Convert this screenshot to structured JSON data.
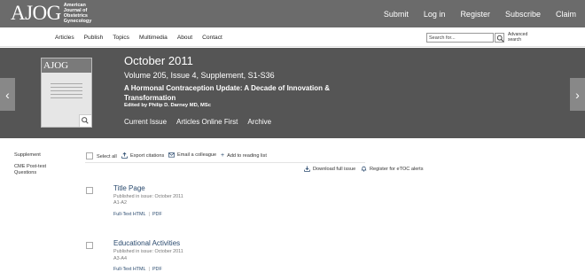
{
  "header": {
    "logo_main": "AJOG",
    "logo_sub": [
      "American",
      "Journal of",
      "Obstetrics",
      "Gynecology"
    ],
    "nav": [
      "Submit",
      "Log in",
      "Register",
      "Subscribe",
      "Claim"
    ]
  },
  "secondary_nav": {
    "items": [
      "Articles",
      "Publish",
      "Topics",
      "Multimedia",
      "About",
      "Contact"
    ],
    "search_placeholder": "Search for...",
    "advanced_search": [
      "Advanced",
      "search"
    ]
  },
  "issue": {
    "title": "October 2011",
    "volume": "Volume 205, Issue 4, Supplement, S1-S36",
    "topic": "A Hormonal Contraception Update: A Decade of Innovation & Transformation",
    "editor": "Edited by Philip D. Darney MD, MSc",
    "links": [
      "Current Issue",
      "Articles Online First",
      "Archive"
    ],
    "cover_title": "AJOG"
  },
  "sidebar": {
    "items": [
      "Supplement",
      "CME Post-test Questions"
    ]
  },
  "toolbar": {
    "select_all": "Select all",
    "export": "Export citations",
    "email": "Email a colleague",
    "reading_list": "Add to reading list",
    "download": "Download full issue",
    "register_alerts": "Register for eTOC alerts"
  },
  "articles": [
    {
      "title": "Title Page",
      "published": "Published in issue: October 2011",
      "pages": "A1-A2",
      "links": [
        "Full-Text HTML",
        "PDF"
      ]
    },
    {
      "title": "Educational Activities",
      "published": "Published in issue: October 2011",
      "pages": "A3-A4",
      "links": [
        "Full-Text HTML",
        "PDF"
      ]
    }
  ],
  "colors": {
    "topbar": "#6b6b6b",
    "banner": "#555555",
    "link": "#2a4a6e"
  }
}
